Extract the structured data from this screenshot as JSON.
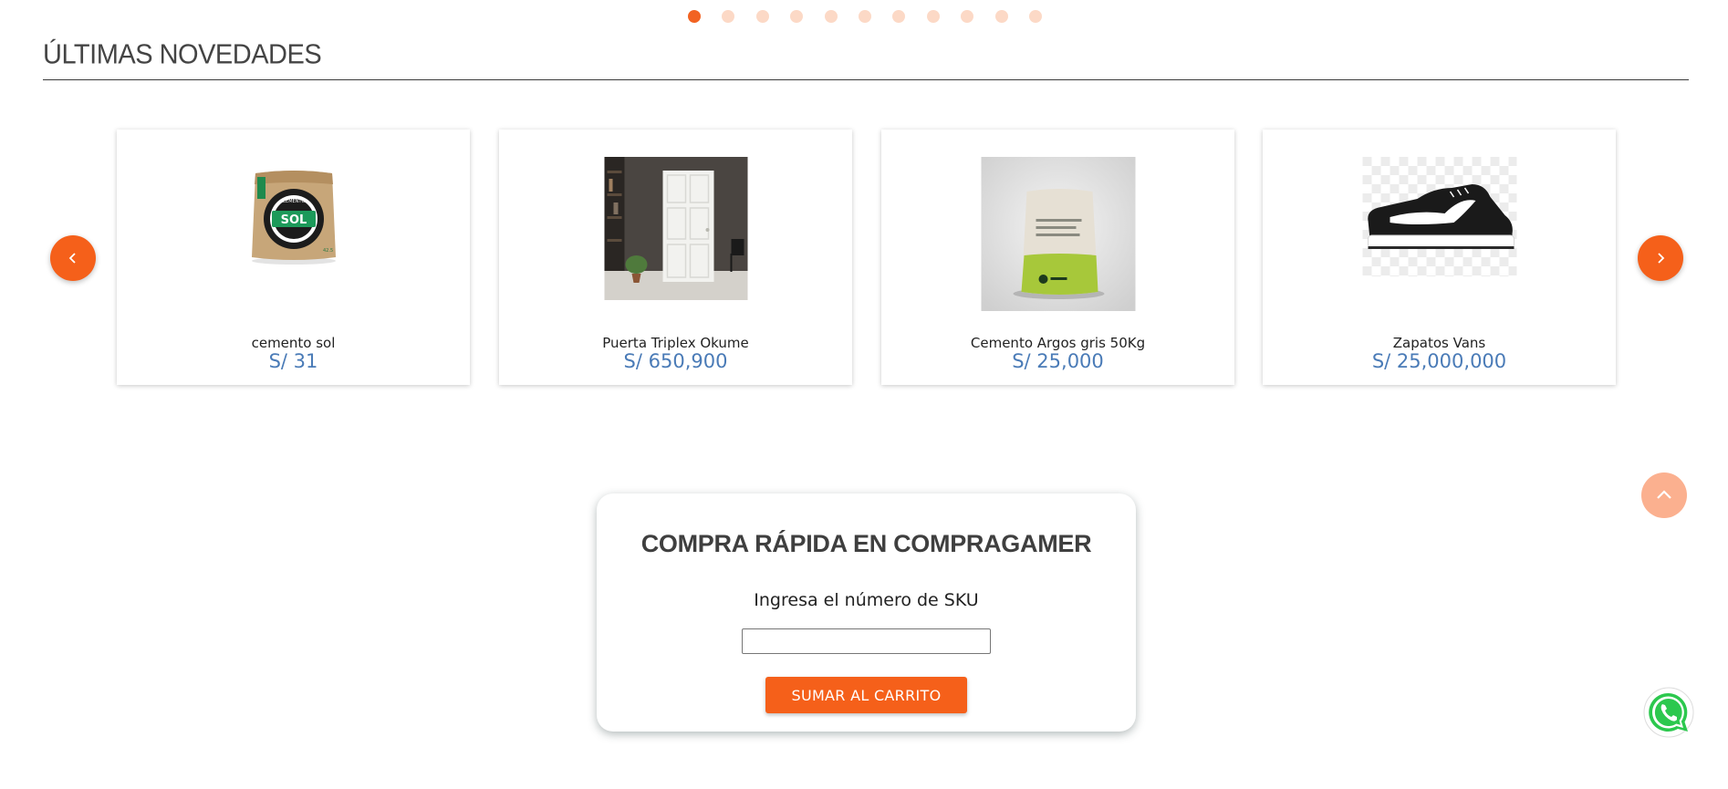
{
  "carousel": {
    "dot_count": 11,
    "active_index": 0,
    "colors": {
      "active": "#f26322",
      "inactive": "#fcd9c6"
    }
  },
  "section": {
    "title": "ÚLTIMAS NOVEDADES"
  },
  "products": [
    {
      "name": "cemento sol",
      "price": "S/ 31",
      "image": "cement-bag-sol"
    },
    {
      "name": "Puerta Triplex Okume",
      "price": "S/ 650,900",
      "image": "door-room"
    },
    {
      "name": "Cemento Argos gris 50Kg",
      "price": "S/ 25,000",
      "image": "cement-bag-argos"
    },
    {
      "name": "Zapatos Vans",
      "price": "S/ 25,000,000",
      "image": "vans-shoe"
    }
  ],
  "quick_buy": {
    "title": "COMPRA RÁPIDA EN COMPRAGAMER",
    "label": "Ingresa el número de SKU",
    "input_value": "",
    "submit_label": "SUMAR AL CARRITO"
  },
  "icons": {
    "prev": "chevron-left-icon",
    "next": "chevron-right-icon",
    "scroll_top": "chevron-up-icon",
    "whatsapp": "whatsapp-icon"
  },
  "colors": {
    "accent": "#f5601a",
    "price": "#4a7bb7",
    "scroll_top": "#fbb08f"
  }
}
